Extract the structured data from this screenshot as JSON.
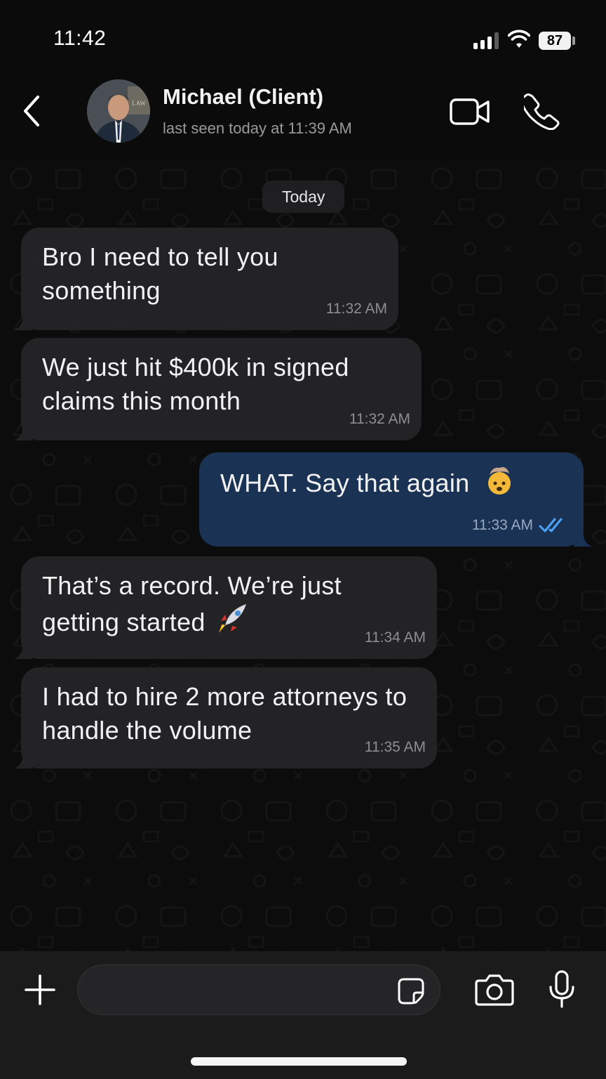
{
  "status_bar": {
    "time": "11:42",
    "battery": "87"
  },
  "header": {
    "back_icon": "chevron-left-icon",
    "contact_name": "Michael (Client)",
    "last_seen": "last seen today at 11:39 AM",
    "avatar_icon": "contact-photo",
    "avatar_sign_text": "LAW",
    "video_icon": "video-camera-icon",
    "call_icon": "phone-icon"
  },
  "chat": {
    "date_label": "Today",
    "messages": [
      {
        "direction": "incoming",
        "text": "Bro I need to tell you something",
        "time": "11:32 AM"
      },
      {
        "direction": "incoming",
        "text": "We just hit $400k in signed claims this month",
        "time": "11:32 AM"
      },
      {
        "direction": "outgoing",
        "text": "WHAT. Say that again",
        "emoji": "exploding-head-emoji",
        "time": "11:33 AM",
        "status": "read-double-check-icon"
      },
      {
        "direction": "incoming",
        "text": "That’s a record. We’re just getting started",
        "emoji": "rocket-emoji",
        "time": "11:34 AM"
      },
      {
        "direction": "incoming",
        "text": "I had to hire 2 more attorneys to handle the volume",
        "time": "11:35 AM"
      }
    ]
  },
  "input_bar": {
    "plus_icon": "plus-icon",
    "message_value": "",
    "message_placeholder": "",
    "sticker_icon": "sticker-icon",
    "camera_icon": "camera-icon",
    "mic_icon": "microphone-icon"
  },
  "colors": {
    "background": "#0b0b0b",
    "incoming_bubble": "#232325",
    "outgoing_bubble": "#1a3354",
    "read_receipt": "#4fa3f7",
    "meta_text": "#8e8e8e"
  }
}
